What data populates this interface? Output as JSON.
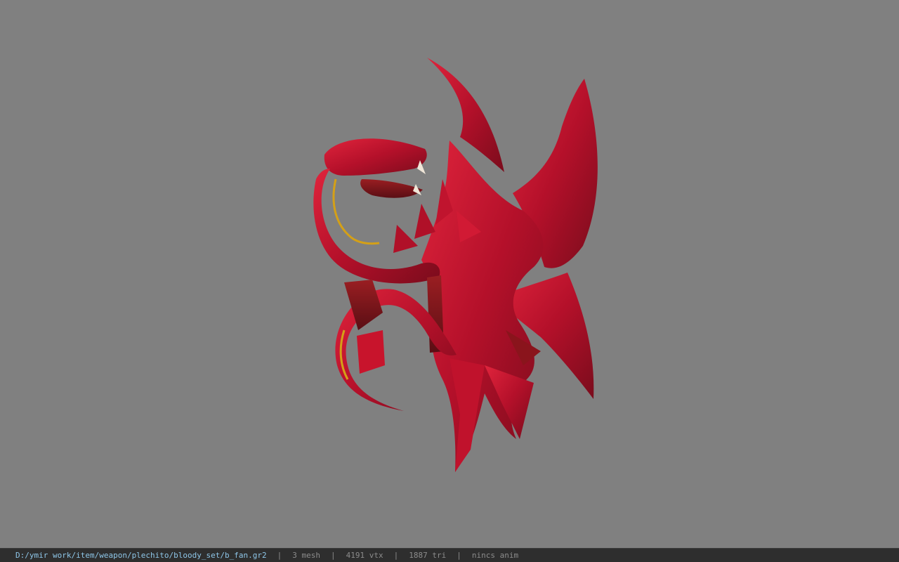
{
  "viewer": {
    "background_color": "#808080",
    "model_name": "b_fan"
  },
  "status": {
    "path": "D:/ymir work/item/weapon/plechito/bloody_set/b_fan.gr2",
    "separator": "|",
    "mesh": "3 mesh",
    "vertices": "4191 vtx",
    "triangles": "1887 tri",
    "anim": "nincs anim"
  },
  "colors": {
    "status_bg": "#2e2e2e",
    "path_color": "#8ec6e8",
    "model_red": "#c8102e",
    "model_dark": "#6e1018",
    "accent_gold": "#d4a017"
  }
}
